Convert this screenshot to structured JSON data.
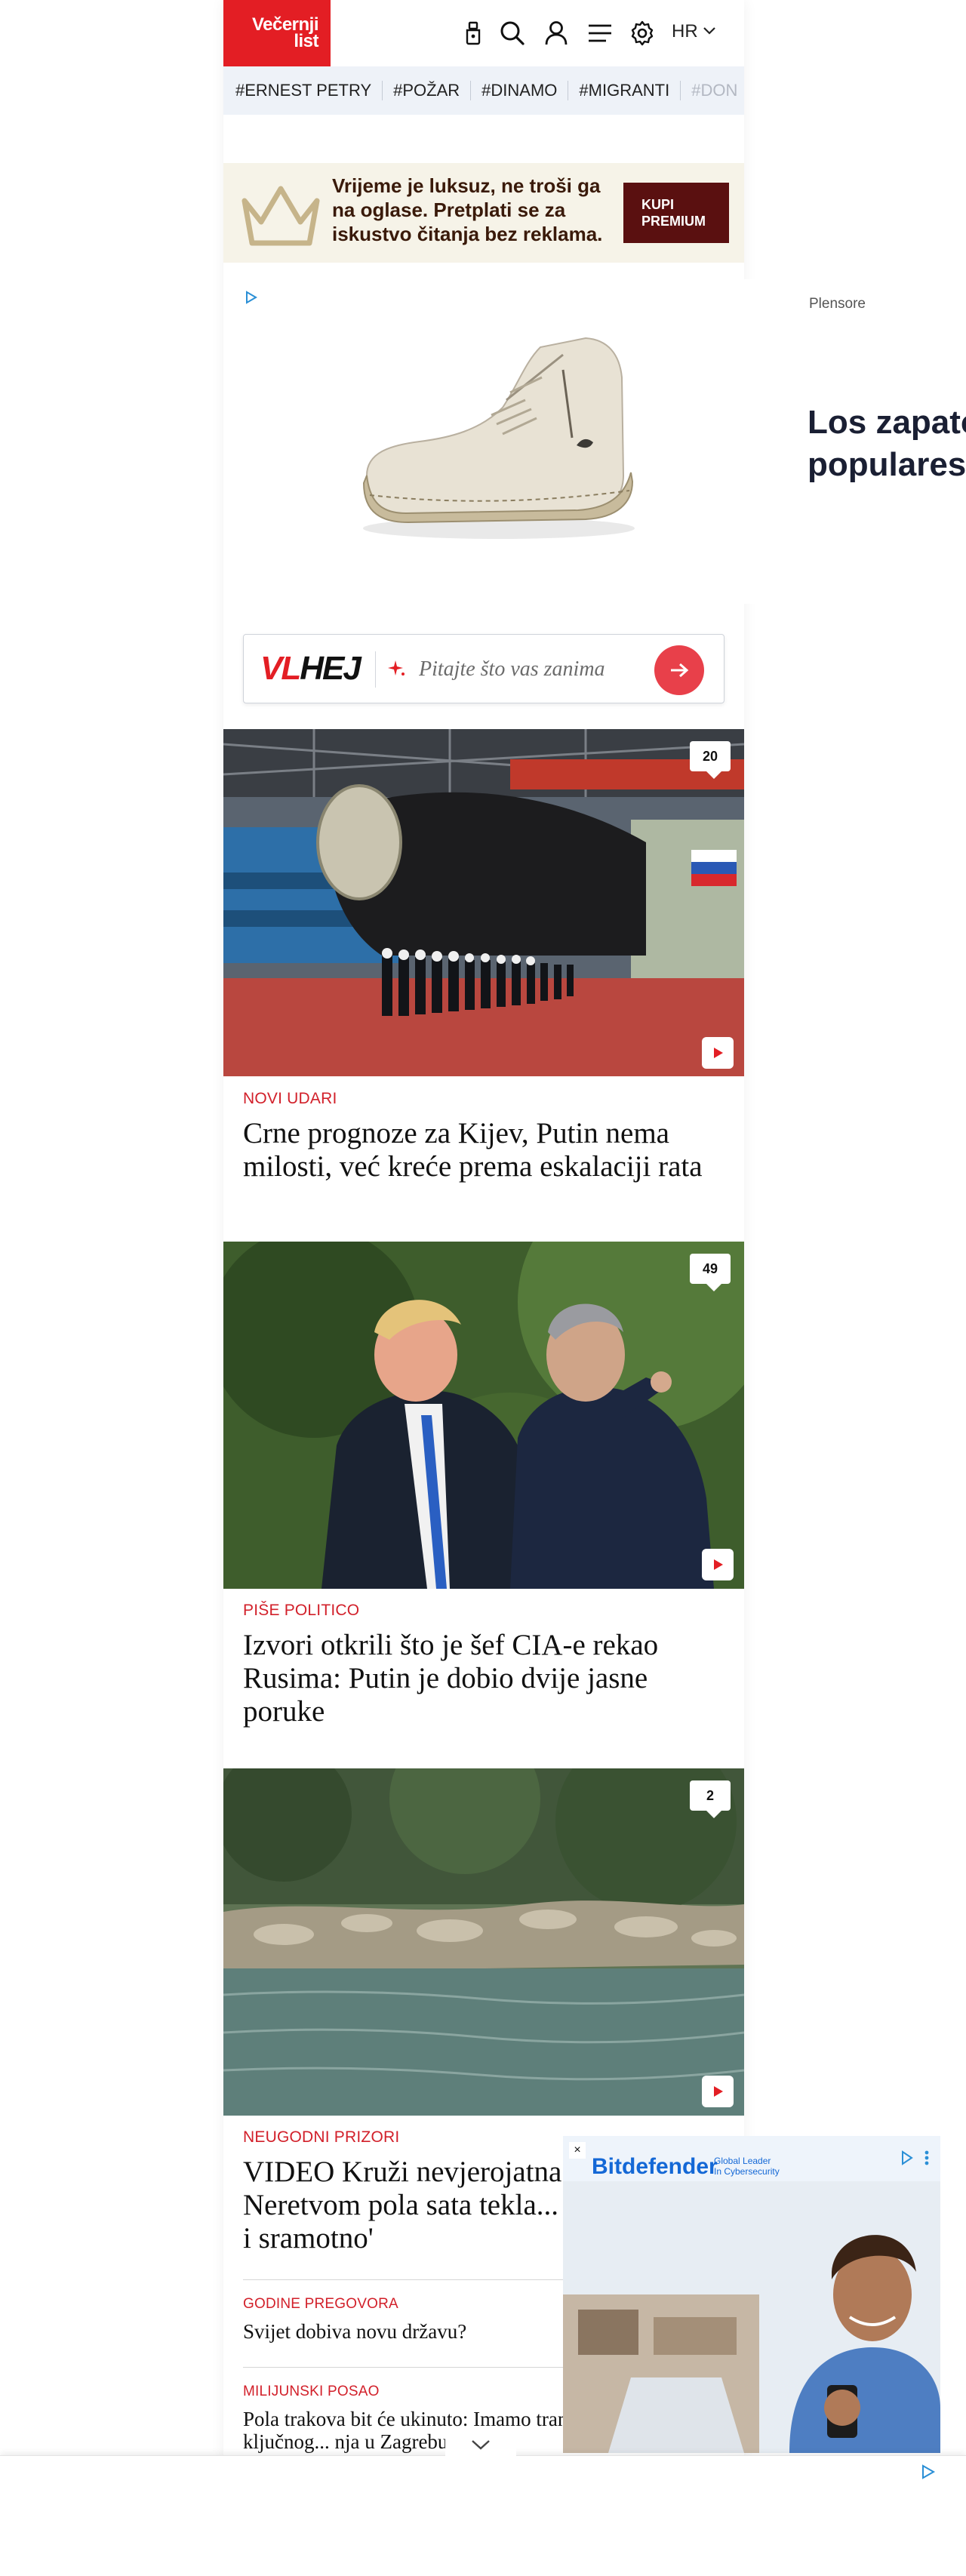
{
  "header": {
    "logo_line1": "Večernji",
    "logo_line2": "list",
    "language": "HR",
    "icons": [
      "flashlight-icon",
      "search-icon",
      "user-icon",
      "menu-icon",
      "gear-icon",
      "chevron-down-icon"
    ]
  },
  "tags": [
    "#ERNEST PETRY",
    "#POŽAR",
    "#DINAMO",
    "#MIGRANTI",
    "#DON"
  ],
  "subscribe": {
    "text": "Vrijeme je luksuz, ne troši ga na oglase. Pretplati se za iskustvo čitanja bez reklama.",
    "button_line1": "KUPI",
    "button_line2": "PREMIUM"
  },
  "ad": {
    "sponsor": "Plensore",
    "headline_line1": "Los zapatos",
    "headline_line2": "populares"
  },
  "vlhej": {
    "logo_vl": "VL",
    "logo_hej": "HEJ",
    "placeholder": "Pitajte što vas zanima"
  },
  "articles": [
    {
      "comments": "20",
      "kicker": "NOVI UDARI",
      "headline": "Crne prognoze za Kijev, Putin nema milosti, već kreće prema eskalaciji rata"
    },
    {
      "comments": "49",
      "kicker": "PIŠE POLITICO",
      "headline": "Izvori otkrili što je šef CIA-e rekao Rusima: Putin je dobio dvije jasne poruke"
    },
    {
      "comments": "2",
      "kicker": "NEUGODNI PRIZORI",
      "headline": "VIDEO Kruži nevjerojatna snimka s Neretvom pola sata tekla... 'Nedopustivo i sramotno'"
    }
  ],
  "small_articles": [
    {
      "kicker": "GODINE PREGOVORA",
      "headline": "Svijet dobiva novu državu?"
    },
    {
      "kicker": "MILIJUNSKI POSAO",
      "headline": "Pola trakova bit će ukinuto: Imamo transformacije ključnog... nja u Zagrebu"
    }
  ],
  "bitdefender": {
    "logo": "Bitdefender",
    "tagline_line1": "Global Leader",
    "tagline_line2": "In Cybersecurity",
    "close": "×"
  },
  "colors": {
    "brand_red": "#e31e24",
    "kicker_red": "#d2202a",
    "premium_button": "#5a1010",
    "tag_bar_bg": "#eef2f8"
  }
}
